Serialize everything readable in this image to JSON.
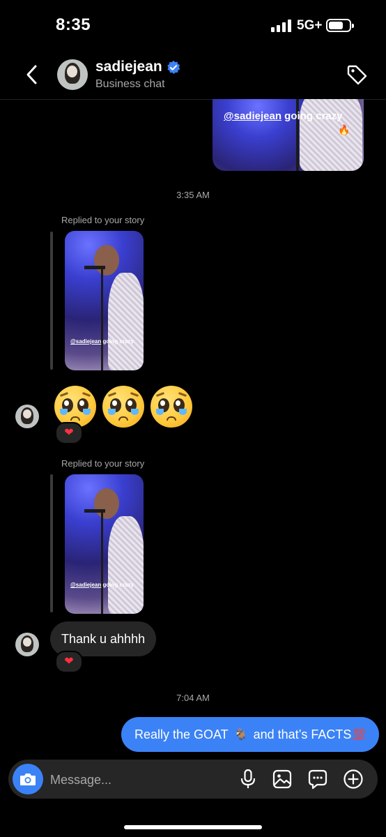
{
  "status_bar": {
    "time": "8:35",
    "network": "5G+"
  },
  "header": {
    "name": "sadiejean",
    "subtitle": "Business chat",
    "verified": true
  },
  "story_caption": {
    "mention": "@sadiejean",
    "text": "going crazy"
  },
  "messages": {
    "timestamp_1": "3:35 AM",
    "replied_label_1": "Replied to your story",
    "emoji_reply": "🥺🥺🥺",
    "reaction_1": "❤",
    "replied_label_2": "Replied to your story",
    "text_reply": "Thank u ahhhh",
    "reaction_2": "❤",
    "timestamp_2": "7:04 AM",
    "outgoing": {
      "part1": "Really the GOAT",
      "goat": "🐐",
      "part2": "and that’s FACTS",
      "hundred": "💯"
    }
  },
  "composer": {
    "placeholder": "Message..."
  },
  "colors": {
    "accent": "#3b82f6",
    "incoming_bubble": "#262626",
    "background": "#000000",
    "heart": "#ff3040"
  }
}
